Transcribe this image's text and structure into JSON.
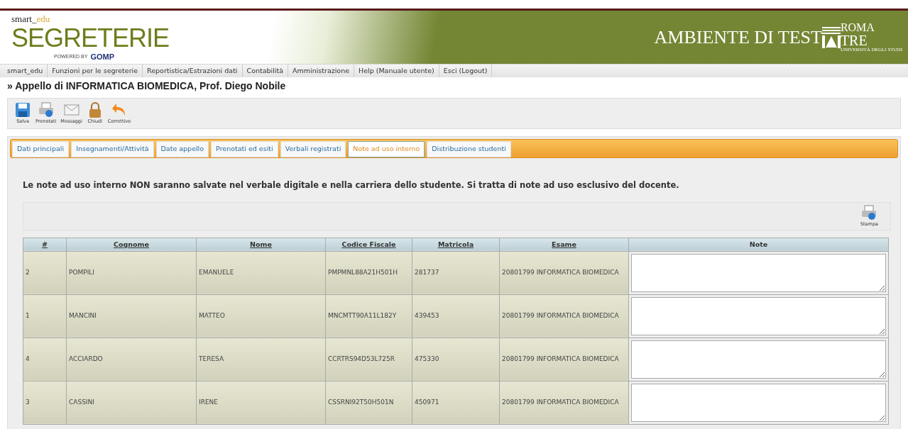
{
  "header": {
    "brand_small_1": "smart_",
    "brand_small_2": "edu",
    "brand": "SEGRETERIE",
    "powered_by": "POWERED BY",
    "powered_brand": "GOMP",
    "environment": "AMBIENTE DI TEST",
    "university_top": "ROMA",
    "university_mid": "TRE",
    "university_bottom": "UNIVERSITÀ DEGLI STUDI"
  },
  "menu": [
    "smart_edu",
    "Funzioni per le segreterie",
    "Reportistica/Estrazioni dati",
    "Contabilità",
    "Amministrazione",
    "Help (Manuale utente)",
    "Esci (Logout)"
  ],
  "page_title": "» Appello di INFORMATICA BIOMEDICA, Prof. Diego Nobile",
  "toolbar": [
    {
      "kind": "save",
      "label": "Salva"
    },
    {
      "kind": "print",
      "label": "Prenotati"
    },
    {
      "kind": "mail",
      "label": "Messaggi"
    },
    {
      "kind": "lock",
      "label": "Chiudi"
    },
    {
      "kind": "undo",
      "label": "Correttivo"
    }
  ],
  "tabs": [
    {
      "label": "Dati principali",
      "selected": false
    },
    {
      "label": "Insegnamenti/Attività",
      "selected": false
    },
    {
      "label": "Date appello",
      "selected": false
    },
    {
      "label": "Prenotati ed esiti",
      "selected": false
    },
    {
      "label": "Verbali registrati",
      "selected": false
    },
    {
      "label": "Note ad uso interno",
      "selected": true
    },
    {
      "label": "Distribuzione studenti",
      "selected": false
    }
  ],
  "notice": "Le note ad uso interno NON saranno salvate nel verbale digitale e nella carriera dello studente. Si tratta di note ad uso esclusivo del docente.",
  "print_button": {
    "label": "Stampa"
  },
  "table": {
    "columns": [
      {
        "label": "#",
        "sortable": true
      },
      {
        "label": "Cognome",
        "sortable": true
      },
      {
        "label": "Nome",
        "sortable": true
      },
      {
        "label": "Codice Fiscale",
        "sortable": true
      },
      {
        "label": "Matricola",
        "sortable": true
      },
      {
        "label": "Esame",
        "sortable": true
      },
      {
        "label": "Note",
        "sortable": false
      }
    ],
    "rows": [
      {
        "cells": [
          "2",
          "POMPILI",
          "EMANUELE",
          "PMPMNL88A21H501H",
          "281737",
          "20801799 INFORMATICA BIOMEDICA"
        ]
      },
      {
        "cells": [
          "1",
          "MANCINI",
          "MATTEO",
          "MNCMTT90A11L182Y",
          "439453",
          "20801799 INFORMATICA BIOMEDICA"
        ]
      },
      {
        "cells": [
          "4",
          "ACCIARDO",
          "TERESA",
          "CCRTRS94D53L725R",
          "475330",
          "20801799 INFORMATICA BIOMEDICA"
        ]
      },
      {
        "cells": [
          "3",
          "CASSINI",
          "IRENE",
          "CSSRNI92T50H501N",
          "450971",
          "20801799 INFORMATICA BIOMEDICA"
        ]
      }
    ]
  }
}
